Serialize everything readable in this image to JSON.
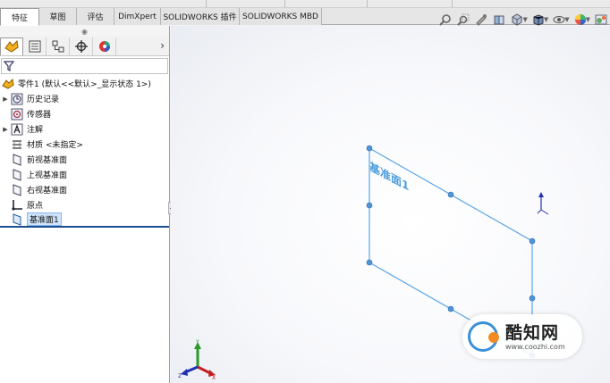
{
  "tabs": [
    {
      "label": "特征",
      "active": true
    },
    {
      "label": "草图",
      "active": false
    },
    {
      "label": "评估",
      "active": false
    },
    {
      "label": "DimXpert",
      "active": false
    },
    {
      "label": "SOLIDWORKS 插件",
      "active": false
    },
    {
      "label": "SOLIDWORKS MBD",
      "active": false
    }
  ],
  "view_toolbar": {
    "icons": [
      "zoom-to-fit-icon",
      "zoom-area-icon",
      "previous-view-icon",
      "section-view-icon",
      "view-orientation-icon",
      "display-style-icon",
      "hide-show-icon",
      "appearance-icon",
      "scene-icon"
    ]
  },
  "feature_manager": {
    "panel_tabs": [
      "feature-manager-icon",
      "property-manager-icon",
      "configuration-manager-icon",
      "dimxpert-manager-icon",
      "display-manager-icon"
    ],
    "root": "零件1 (默认<<默认>_显示状态 1>)",
    "items": [
      {
        "label": "历史记录",
        "expandable": true,
        "icon": "history-icon"
      },
      {
        "label": "传感器",
        "expandable": false,
        "icon": "sensor-icon"
      },
      {
        "label": "注解",
        "expandable": true,
        "icon": "annotation-icon"
      },
      {
        "label": "材质 <未指定>",
        "expandable": false,
        "icon": "material-icon"
      },
      {
        "label": "前视基准面",
        "expandable": false,
        "icon": "plane-icon"
      },
      {
        "label": "上视基准面",
        "expandable": false,
        "icon": "plane-icon"
      },
      {
        "label": "右视基准面",
        "expandable": false,
        "icon": "plane-icon"
      },
      {
        "label": "原点",
        "expandable": false,
        "icon": "origin-icon"
      },
      {
        "label": "基准面1",
        "expandable": false,
        "icon": "plane-icon",
        "selected": true
      }
    ]
  },
  "viewport": {
    "plane_label": "基准面1",
    "triad_labels": {
      "x": "X",
      "y": "Y",
      "z": "Z"
    }
  },
  "watermark": {
    "title": "酷知网",
    "url": "www.coozhi.com"
  },
  "colors": {
    "plane_edge": "#5aa5e6",
    "selection": "#cfe3fb",
    "selection_underline": "#1c4f91"
  }
}
